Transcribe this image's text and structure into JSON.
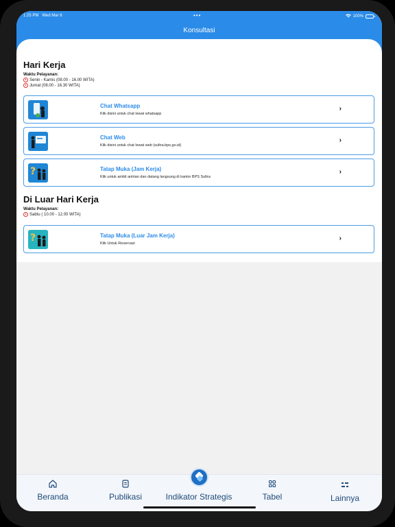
{
  "status_bar": {
    "time": "1:25 PM",
    "date": "Wed Mar 6",
    "dots": "•••",
    "battery": "100%"
  },
  "header": {
    "title": "Konsultasi"
  },
  "working_hours": {
    "title": "Hari Kerja",
    "service_label": "Waktu Pelayanan:",
    "schedule": [
      "Senin - Kamis (08.00 - 16.00 WITA)",
      "Jumat (08.00 - 16.30 WITA)"
    ],
    "cards": [
      {
        "title": "Chat Whatsapp",
        "desc": "Klik disini untuk chat lewat whatsapp",
        "icon": "whatsapp-illustration-icon"
      },
      {
        "title": "Chat Web",
        "desc": "Klik disini untuk chat lewat web (sultra.bps.go.id)",
        "icon": "web-chat-illustration-icon"
      },
      {
        "title": "Tatap Muka (Jam Kerja)",
        "desc": "Klik untuk ambil antrian dan datang langsung di kantor BPS Sultra",
        "icon": "face-to-face-illustration-icon"
      }
    ]
  },
  "off_hours": {
    "title": "Di Luar Hari Kerja",
    "service_label": "Waktu Pelayanan:",
    "schedule": [
      "Sabtu ( 10.00 - 12.00 WITA)"
    ],
    "cards": [
      {
        "title": "Tatap Muka (Luar Jam Kerja)",
        "desc": "Klik Untuk Reservasi",
        "icon": "face-to-face-illustration-icon"
      }
    ]
  },
  "tabbar": {
    "items": [
      {
        "label": "Beranda",
        "icon": "home-icon"
      },
      {
        "label": "Publikasi",
        "icon": "document-icon"
      },
      {
        "label": "Indikator Strategis",
        "icon": "bps-logo-icon"
      },
      {
        "label": "Tabel",
        "icon": "grid-icon"
      },
      {
        "label": "Lainnya",
        "icon": "more-icon"
      }
    ]
  },
  "colors": {
    "primary": "#2b8be8",
    "card_border": "#4a9be6",
    "nav_text": "#1f4a7a",
    "clock": "#e03030"
  }
}
